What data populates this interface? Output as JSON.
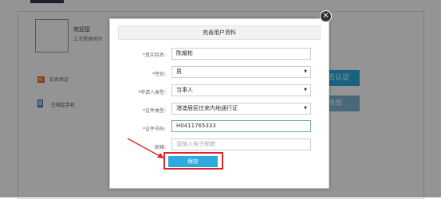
{
  "background": {
    "welcome": "欢迎您",
    "last_login": "上次登录时间",
    "real_name_label": "实名验证",
    "phone_label": "已绑定手机",
    "verify_button": "去认证",
    "modify_button": "修改",
    "accent_color": "#2fa9dd"
  },
  "modal": {
    "title": "完善用户资料",
    "close_symbol": "×",
    "fields": [
      {
        "label": "*真实姓名:",
        "value": "陈耀彬",
        "placeholder": "",
        "type": "text"
      },
      {
        "label": "*性别:",
        "value": "男",
        "placeholder": "",
        "type": "select"
      },
      {
        "label": "*申请人类型:",
        "value": "当事人",
        "placeholder": "",
        "type": "select"
      },
      {
        "label": "*证件类型:",
        "value": "港澳居民往来内地通行证",
        "placeholder": "",
        "type": "select"
      },
      {
        "label": "*证件号码:",
        "value": "H0411765333",
        "placeholder": "",
        "type": "text"
      },
      {
        "label": "邮箱:",
        "value": "",
        "placeholder": "请输入电子邮箱",
        "type": "text"
      }
    ],
    "save_label": "保存",
    "highlight_color": "#d9252c"
  }
}
